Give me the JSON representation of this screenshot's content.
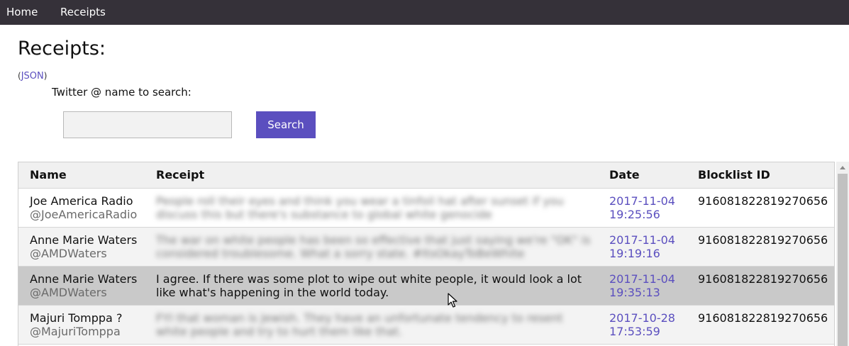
{
  "nav": {
    "home_label": "Home",
    "receipts_label": "Receipts"
  },
  "page": {
    "title": "Receipts:",
    "json_link_label": "JSON",
    "search_label": "Twitter @ name to search:",
    "search_value": "",
    "search_button_label": "Search"
  },
  "table": {
    "headers": {
      "name": "Name",
      "receipt": "Receipt",
      "date": "Date",
      "blocklist_id": "Blocklist ID"
    },
    "rows": [
      {
        "name": "Joe America Radio",
        "handle": "@JoeAmericaRadio",
        "receipt": "People roll their eyes and think you wear a tinfoil hat after sunset if you discuss this but there's substance to global white genocide",
        "receipt_blurred": true,
        "date": "2017-11-04",
        "time": "19:25:56",
        "blocklist_id": "916081822819270656"
      },
      {
        "name": "Anne Marie Waters",
        "handle": "@AMDWaters",
        "receipt": "The war on white people has been so effective that just saying we're \"OK\" is considered troublesome. What a sorry state. #ItsOkayToBeWhite",
        "receipt_blurred": true,
        "date": "2017-11-04",
        "time": "19:19:16",
        "blocklist_id": "916081822819270656"
      },
      {
        "name": "Anne Marie Waters",
        "handle": "@AMDWaters",
        "receipt": "I agree. If there was some plot to wipe out white people, it would look a lot like what's happening in the world today.",
        "receipt_blurred": false,
        "date": "2017-11-04",
        "time": "19:35:13",
        "blocklist_id": "916081822819270656"
      },
      {
        "name": "Majuri Tomppa ?",
        "handle": "@MajuriTomppa",
        "receipt": "FYI that woman is Jewish. They have an unfortunate tendency to resent white people and try to hurt them like that.",
        "receipt_blurred": true,
        "date": "2017-10-28",
        "time": "17:53:59",
        "blocklist_id": "916081822819270656"
      }
    ]
  },
  "colors": {
    "navbar": "#353139",
    "accent": "#5b4fbf",
    "selected_row": "#c9c9c9"
  },
  "icons": [
    "scroll-up-icon",
    "mouse-cursor-icon"
  ]
}
